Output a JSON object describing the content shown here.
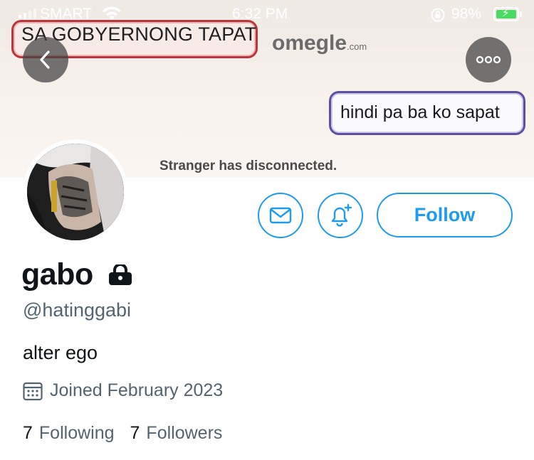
{
  "status_bar": {
    "carrier": "SMART",
    "time": "6:32 PM",
    "battery_percent": "98%"
  },
  "banner": {
    "top_text": "SA GOBYERNONG TAPAT",
    "logo_text": "omegle",
    "logo_suffix": ".com",
    "chat_message": "hindi pa ba ko sapat",
    "disconnect_text": "Stranger has disconnected."
  },
  "profile": {
    "display_name": "gabo",
    "handle": "@hatinggabi",
    "bio": "alter ego",
    "joined": "Joined February 2023",
    "following_count": "7",
    "following_label": "Following",
    "followers_count": "7",
    "followers_label": "Followers"
  },
  "actions": {
    "follow_label": "Follow"
  },
  "colors": {
    "accent": "#1d9bf0",
    "secondary_text": "#536471",
    "primary_text": "#0f1419"
  },
  "icons": [
    "back-arrow-icon",
    "more-icon",
    "mail-icon",
    "bell-plus-icon",
    "lock-icon",
    "calendar-icon",
    "wifi-icon",
    "signal-icon",
    "battery-icon",
    "rotation-lock-icon"
  ]
}
